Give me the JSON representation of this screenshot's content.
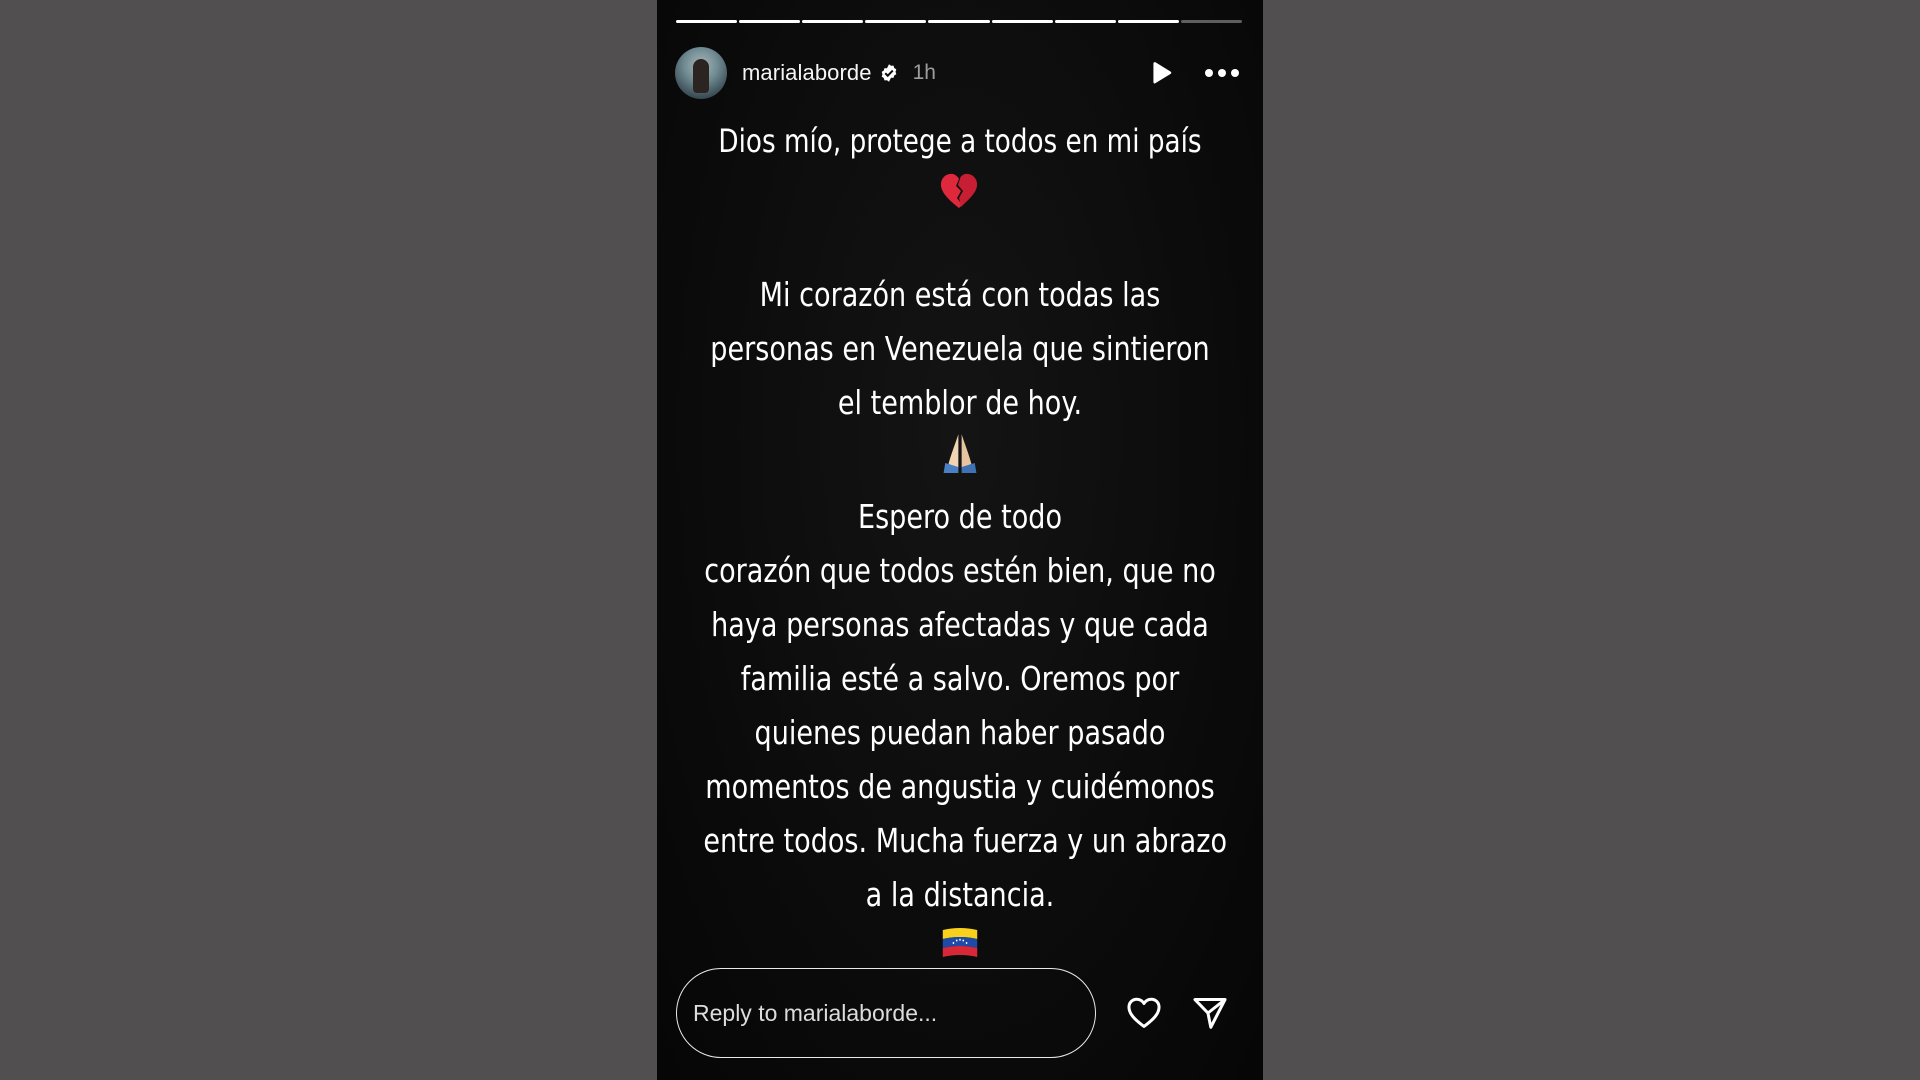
{
  "story": {
    "progress_total": 9,
    "progress_done": 8,
    "author": {
      "username": "marialaborde",
      "verified": true,
      "time_ago": "1h",
      "avatar_icon": "profile-photo"
    },
    "controls": {
      "play_icon": "play-icon",
      "more_icon": "more-icon"
    },
    "text": {
      "line1": "Dios mío, protege a todos en mi país",
      "emoji1": "broken-heart",
      "body_lines": [
        "Mi corazón está con todas las",
        "personas en Venezuela que sintieron",
        "el temblor de hoy.",
        "Espero de todo",
        "corazón que todos estén bien, que no",
        "haya personas afectadas y que cada",
        "familia esté a salvo. Oremos por",
        "quienes puedan haber pasado",
        "momentos de angustia y cuidémonos",
        "entre todos. Mucha fuerza y un abrazo",
        "a la distancia."
      ]
    },
    "footer": {
      "reply_placeholder": "Reply to marialaborde...",
      "like_icon": "heart-icon",
      "send_icon": "send-icon"
    }
  },
  "colors": {
    "page_background": "#514f50",
    "story_background": "#0a0a0a",
    "text": "#ffffff",
    "muted": "#9d9d9d"
  }
}
